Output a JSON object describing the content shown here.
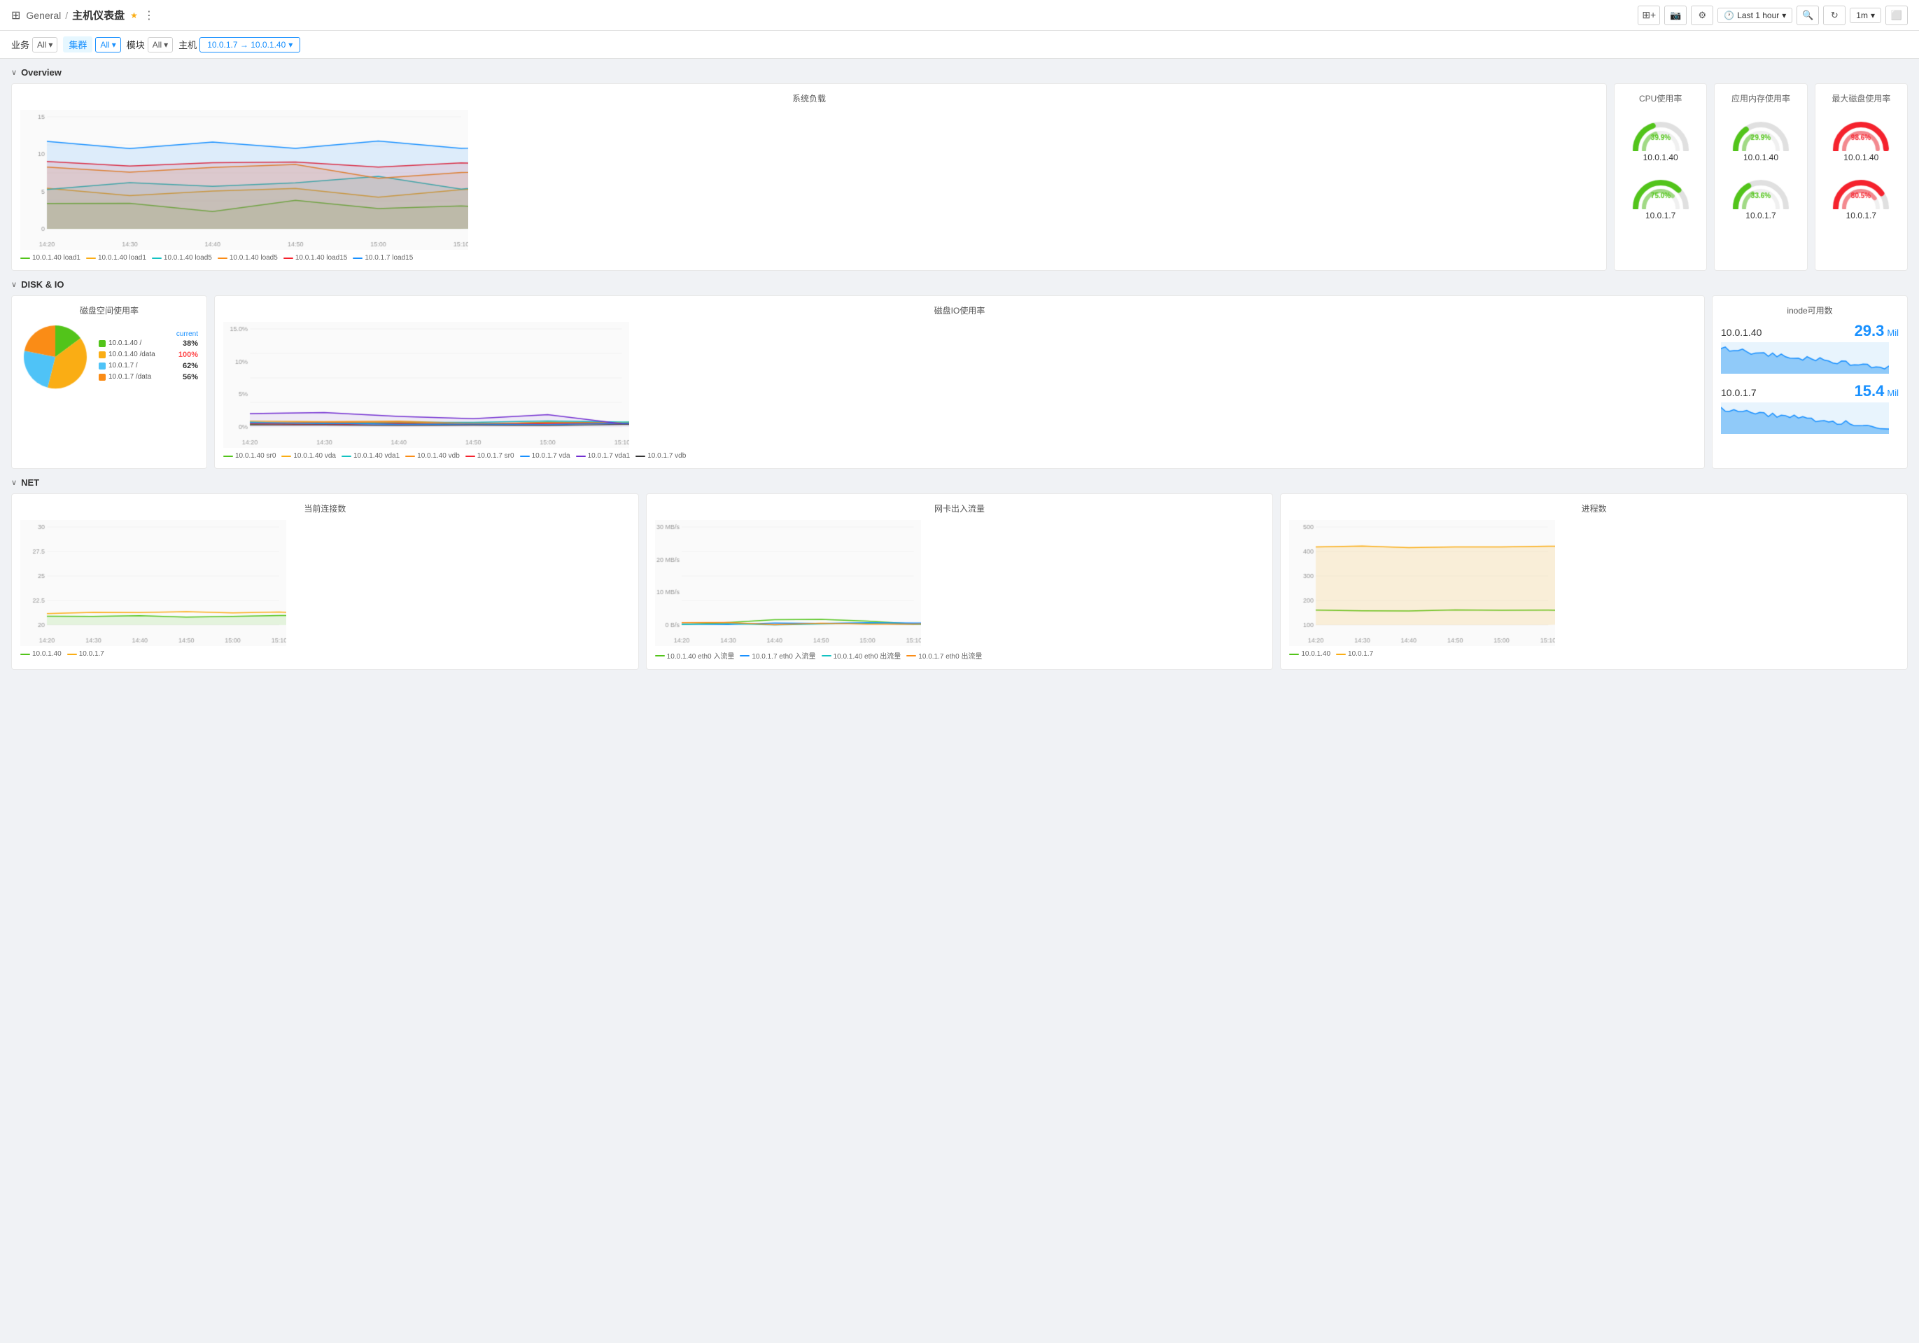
{
  "header": {
    "general_label": "General",
    "separator": "/",
    "title": "主机仪表盘",
    "star_icon": "★",
    "share_icon": "⋮",
    "add_panel_btn": "📊+",
    "camera_btn": "📷",
    "settings_btn": "⚙",
    "time_range": "Last 1 hour",
    "zoom_out_btn": "🔍-",
    "refresh_btn": "↻",
    "interval": "1m",
    "tv_btn": "📺"
  },
  "filters": {
    "business_label": "业务",
    "business_value": "All",
    "cluster_label": "集群",
    "cluster_value": "All",
    "module_label": "模块",
    "module_value": "All",
    "host_label": "主机",
    "host_value": "10.0.1.7 → 10.0.1.40"
  },
  "sections": {
    "overview": {
      "toggle": "∨",
      "title": "Overview",
      "system_load": {
        "title": "系统负载",
        "legend": [
          {
            "color": "#52c41a",
            "label": "10.0.1.40 load1"
          },
          {
            "color": "#faad14",
            "label": "10.0.1.40 load1"
          },
          {
            "color": "#13c2c2",
            "label": "10.0.1.40 load5"
          },
          {
            "color": "#fa8c16",
            "label": "10.0.1.40 load5"
          },
          {
            "color": "#f5222d",
            "label": "10.0.1.40 load15"
          },
          {
            "color": "#1890ff",
            "label": "10.0.1.7 load15"
          }
        ],
        "y_max": 15,
        "y_labels": [
          "15",
          "10",
          "5",
          "0"
        ],
        "x_labels": [
          "14:20",
          "14:30",
          "14:40",
          "14:50",
          "15:00",
          "15:10"
        ]
      },
      "cpu": {
        "title": "CPU使用率",
        "host1": {
          "name": "10.0.1.40",
          "value": "39.9%",
          "pct": 39.9,
          "color": "#52c41a"
        },
        "host2": {
          "name": "10.0.1.7",
          "value": "75.0%",
          "pct": 75.0,
          "color": "#52c41a"
        }
      },
      "memory": {
        "title": "应用内存使用率",
        "host1": {
          "name": "10.0.1.40",
          "value": "29.9%",
          "pct": 29.9,
          "color": "#52c41a"
        },
        "host2": {
          "name": "10.0.1.7",
          "value": "33.6%",
          "pct": 33.6,
          "color": "#52c41a"
        }
      },
      "disk_usage": {
        "title": "最大磁盘使用率",
        "host1": {
          "name": "10.0.1.40",
          "value": "98.6%",
          "pct": 98.6,
          "color": "#f5222d"
        },
        "host2": {
          "name": "10.0.1.7",
          "value": "80.5%",
          "pct": 80.5,
          "color": "#f5222d"
        }
      }
    },
    "disk_io": {
      "toggle": "∨",
      "title": "DISK & IO",
      "disk_space": {
        "title": "磁盘空间使用率",
        "current_label": "current",
        "items": [
          {
            "color": "#52c41a",
            "label": "10.0.1.40 /",
            "pct": "38%",
            "high": false
          },
          {
            "color": "#faad14",
            "label": "10.0.1.40 /data",
            "pct": "100%",
            "high": true
          },
          {
            "color": "#13c2c2",
            "label": "10.0.1.7 /",
            "pct": "62%",
            "high": false
          },
          {
            "color": "#fa8c16",
            "label": "10.0.1.7 /data",
            "pct": "56%",
            "high": false
          }
        ],
        "pie_colors": [
          "#52c41a",
          "#faad14",
          "#4fc3f7",
          "#fa8c16"
        ]
      },
      "disk_io_chart": {
        "title": "磁盘IO使用率",
        "y_labels": [
          "15.0%",
          "10%",
          "5%",
          "0%"
        ],
        "x_labels": [
          "14:20",
          "14:30",
          "14:40",
          "14:50",
          "15:00",
          "15:10"
        ],
        "legend": [
          {
            "color": "#52c41a",
            "label": "10.0.1.40 sr0"
          },
          {
            "color": "#faad14",
            "label": "10.0.1.40 vda"
          },
          {
            "color": "#13c2c2",
            "label": "10.0.1.40 vda1"
          },
          {
            "color": "#fa8c16",
            "label": "10.0.1.40 vdb"
          },
          {
            "color": "#f5222d",
            "label": "10.0.1.7 sr0"
          },
          {
            "color": "#1890ff",
            "label": "10.0.1.7 vda"
          },
          {
            "color": "#722ed1",
            "label": "10.0.1.7 vda1"
          },
          {
            "color": "#333",
            "label": "10.0.1.7 vdb"
          }
        ]
      },
      "inode": {
        "title": "inode可用数",
        "host1": {
          "name": "10.0.1.40",
          "value": "29.3",
          "unit": "Mil"
        },
        "host2": {
          "name": "10.0.1.7",
          "value": "15.4",
          "unit": "Mil"
        }
      }
    },
    "net": {
      "toggle": "∨",
      "title": "NET",
      "connections": {
        "title": "当前连接数",
        "y_labels": [
          "30",
          "27.5",
          "25",
          "22.5",
          "20"
        ],
        "x_labels": [
          "14:20",
          "14:30",
          "14:40",
          "14:50",
          "15:00",
          "15:10"
        ],
        "legend": [
          {
            "color": "#52c41a",
            "label": "10.0.1.40"
          },
          {
            "color": "#faad14",
            "label": "10.0.1.7"
          }
        ]
      },
      "traffic": {
        "title": "网卡出入流量",
        "y_labels": [
          "30 MB/s",
          "20 MB/s",
          "10 MB/s",
          "0 B/s"
        ],
        "x_labels": [
          "14:20",
          "14:30",
          "14:40",
          "14:50",
          "15:00",
          "15:10"
        ],
        "legend": [
          {
            "color": "#52c41a",
            "label": "10.0.1.40 eth0 入流量"
          },
          {
            "color": "#1890ff",
            "label": "10.0.1.7 eth0 入流量"
          },
          {
            "color": "#13c2c2",
            "label": "10.0.1.40 eth0 出流量"
          },
          {
            "color": "#fa8c16",
            "label": "10.0.1.7 eth0 出流量"
          }
        ]
      },
      "processes": {
        "title": "进程数",
        "y_labels": [
          "500",
          "400",
          "300",
          "200",
          "100"
        ],
        "x_labels": [
          "14:20",
          "14:30",
          "14:40",
          "14:50",
          "15:00",
          "15:10"
        ],
        "legend": [
          {
            "color": "#52c41a",
            "label": "10.0.1.40"
          },
          {
            "color": "#faad14",
            "label": "10.0.1.7"
          }
        ]
      }
    }
  }
}
